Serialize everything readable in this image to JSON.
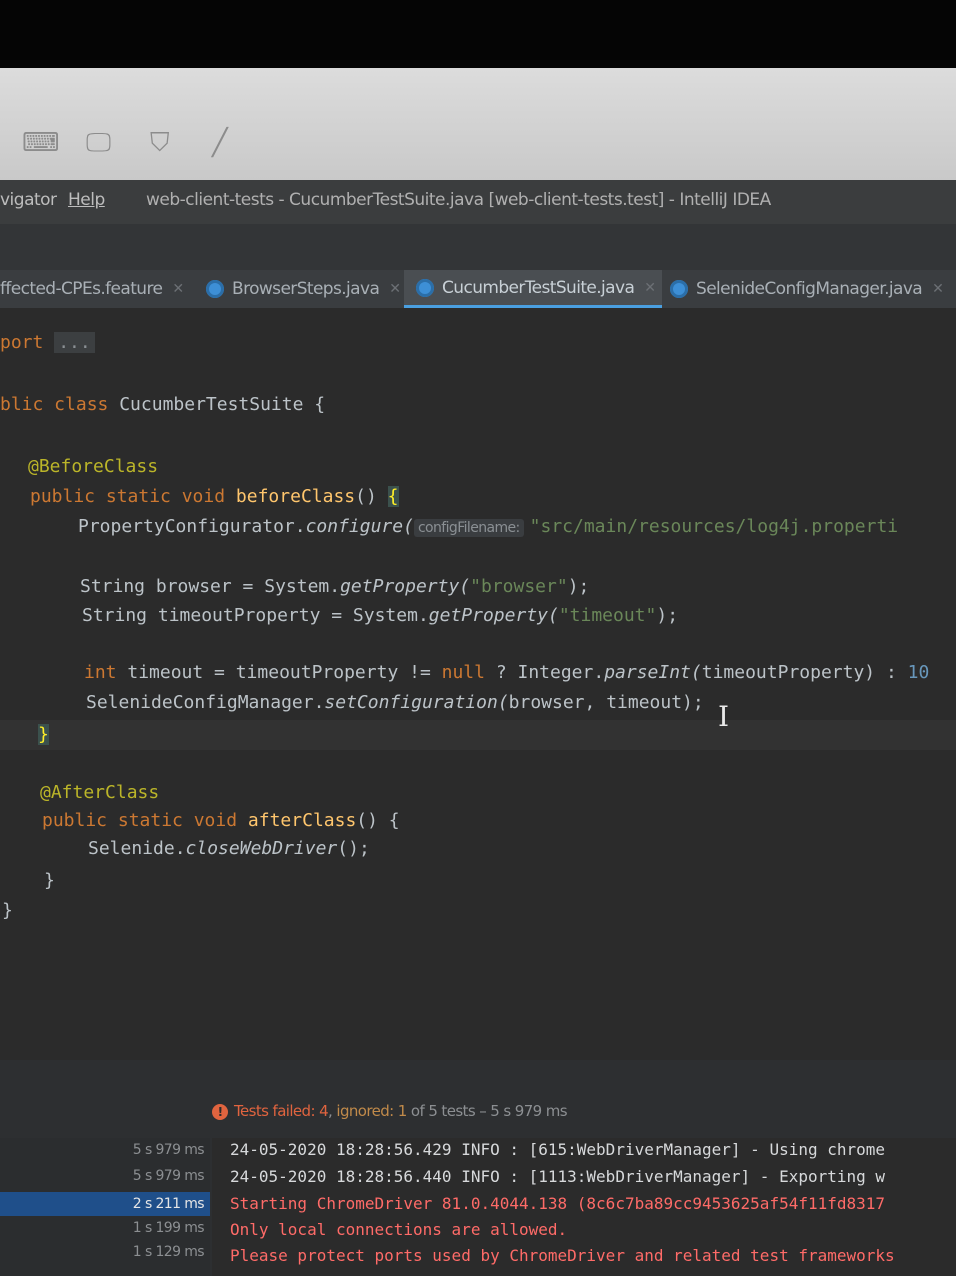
{
  "window": {
    "menu": [
      "vigator",
      "Help"
    ],
    "title": "web-client-tests - CucumberTestSuite.java [web-client-tests.test] - IntelliJ IDEA"
  },
  "tabs": [
    {
      "label": "ffected-CPEs.feature",
      "active": false
    },
    {
      "label": "BrowserSteps.java",
      "active": false
    },
    {
      "label": "CucumberTestSuite.java",
      "active": true
    },
    {
      "label": "SelenideConfigManager.java",
      "active": false
    }
  ],
  "code": {
    "import_kw": "port",
    "import_fold": "...",
    "class_mod": "blic class",
    "class_name": "CucumberTestSuite {",
    "before_ann": "@BeforeClass",
    "before_mods": "public static void",
    "before_name": "beforeClass",
    "before_open": "() ",
    "brace_open": "{",
    "l_configure_call": "PropertyConfigurator.",
    "l_configure_fn": "configure(",
    "l_configure_hint": "configFilename:",
    "l_configure_str": "\"src/main/resources/log4j.properti",
    "l_browser_a": "String browser = System.",
    "l_browser_fn": "getProperty(",
    "l_browser_str": "\"browser\"",
    "l_browser_end": ");",
    "l_timeout_a": "String timeoutProperty = System.",
    "l_timeout_fn": "getProperty(",
    "l_timeout_str": "\"timeout\"",
    "l_timeout_end": ");",
    "l_int_kw": "int",
    "l_int_a": " timeout = timeoutProperty != ",
    "l_int_null": "null",
    "l_int_b": " ? Integer.",
    "l_int_fn": "parseInt(",
    "l_int_c": "timeoutProperty) : ",
    "l_int_num": "10",
    "l_set_a": "SelenideConfigManager.",
    "l_set_fn": "setConfiguration(",
    "l_set_b": "browser, timeout);",
    "brace_close": "}",
    "after_ann": "@AfterClass",
    "after_mods": "public static void",
    "after_name": "afterClass",
    "after_open": "() {",
    "l_close_a": "Selenide.",
    "l_close_fn": "closeWebDriver",
    "l_close_b": "();",
    "after_close": "}",
    "class_close": "}"
  },
  "run": {
    "status_failed": "Tests failed: 4",
    "status_sep": ", ",
    "status_ignored": "ignored: 1",
    "status_rest": " of 5 tests – 5 s 979 ms",
    "times": [
      "5 s 979 ms",
      "5 s 979 ms",
      "2 s 211 ms",
      "1 s 199 ms",
      "1 s 129 ms"
    ],
    "selected_time_index": 2,
    "console": [
      {
        "text": "24-05-2020 18:28:56.429 INFO : [615:WebDriverManager] - Using chrome",
        "level": "info"
      },
      {
        "text": "24-05-2020 18:28:56.440 INFO : [1113:WebDriverManager] - Exporting w",
        "level": "info"
      },
      {
        "text": "Starting ChromeDriver 81.0.4044.138 (8c6c7ba89cc9453625af54f11fd8317",
        "level": "error"
      },
      {
        "text": "Only local connections are allowed.",
        "level": "error"
      },
      {
        "text": "Please protect ports used by ChromeDriver and related test frameworks",
        "level": "error"
      }
    ]
  },
  "colors": {
    "editor_bg": "#2b2b2b",
    "keyword": "#cc7832",
    "annotation": "#bbb529",
    "method": "#ffc66d",
    "string": "#6a8759",
    "accent": "#4a9fe0",
    "error": "#ff6b68"
  }
}
